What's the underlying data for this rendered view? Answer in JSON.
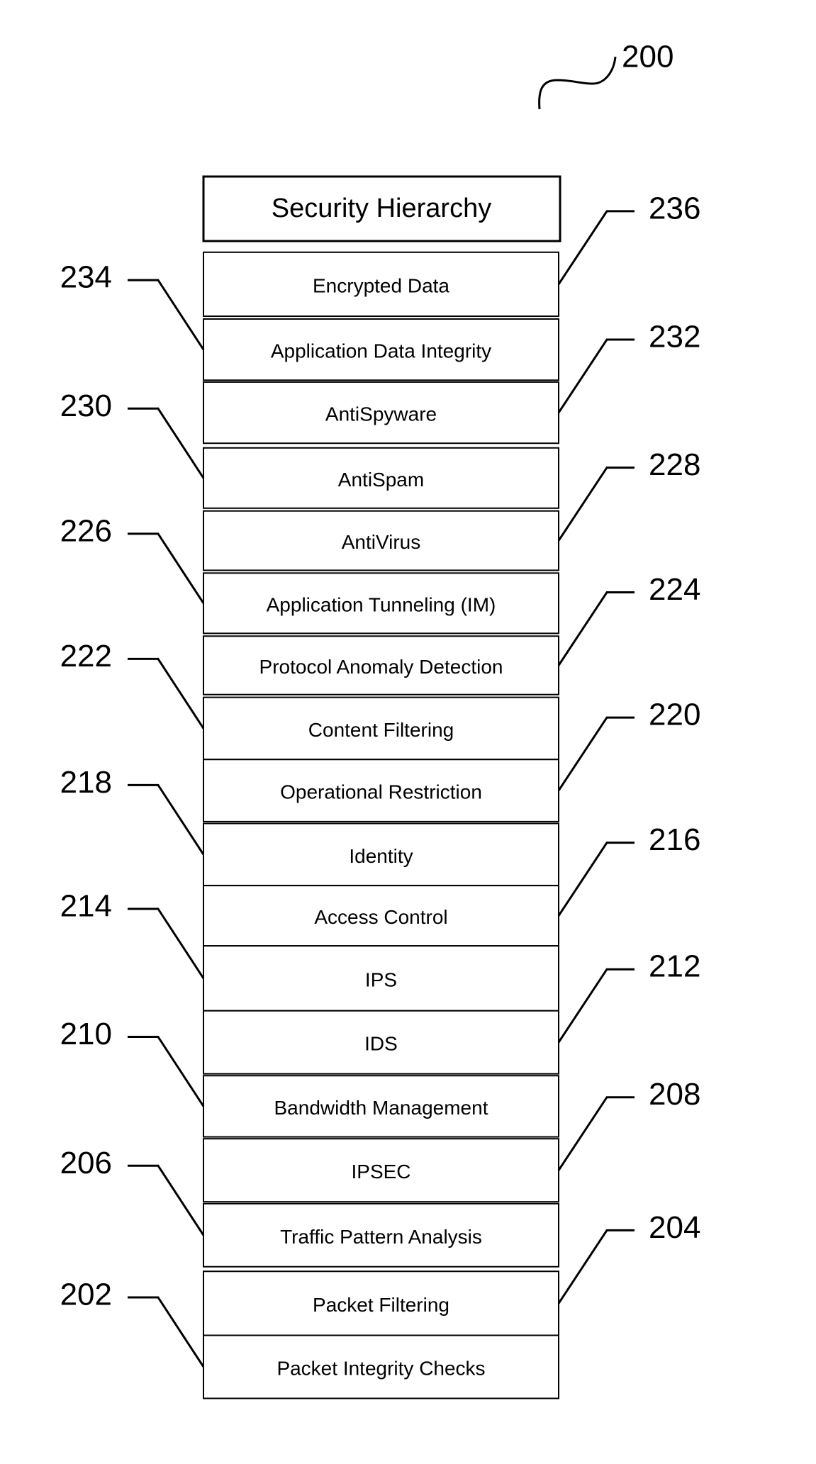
{
  "figure": {
    "reference_number": "200",
    "title": "Security Hierarchy"
  },
  "layers": [
    {
      "label": "Encrypted Data",
      "ref": "236",
      "side": "right"
    },
    {
      "label": "Application Data Integrity",
      "ref": "234",
      "side": "left"
    },
    {
      "label": "AntiSpyware",
      "ref": "232",
      "side": "right"
    },
    {
      "label": "AntiSpam",
      "ref": "230",
      "side": "left"
    },
    {
      "label": "AntiVirus",
      "ref": "228",
      "side": "right"
    },
    {
      "label": "Application Tunneling (IM)",
      "ref": "226",
      "side": "left"
    },
    {
      "label": "Protocol Anomaly Detection",
      "ref": "224",
      "side": "right"
    },
    {
      "label": "Content Filtering",
      "ref": "222",
      "side": "left"
    },
    {
      "label": "Operational Restriction",
      "ref": "220",
      "side": "right"
    },
    {
      "label": "Identity",
      "ref": "218",
      "side": "left"
    },
    {
      "label": "Access Control",
      "ref": "216",
      "side": "right"
    },
    {
      "label": "IPS",
      "ref": "214",
      "side": "left"
    },
    {
      "label": "IDS",
      "ref": "212",
      "side": "right"
    },
    {
      "label": "Bandwidth Management",
      "ref": "210",
      "side": "left"
    },
    {
      "label": "IPSEC",
      "ref": "208",
      "side": "right"
    },
    {
      "label": "Traffic Pattern Analysis",
      "ref": "206",
      "side": "left"
    },
    {
      "label": "Packet Filtering",
      "ref": "204",
      "side": "right"
    },
    {
      "label": "Packet Integrity Checks",
      "ref": "202",
      "side": "left"
    }
  ]
}
